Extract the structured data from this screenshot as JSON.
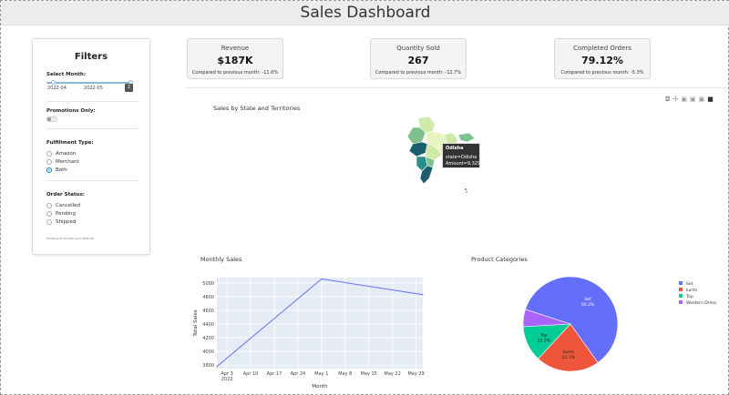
{
  "app": {
    "title": "Sales Dashboard"
  },
  "filters": {
    "title": "Filters",
    "select_month": {
      "label": "Select Month:",
      "tick_start": "2022-04",
      "tick_end": "2022-05",
      "handle_value": "2"
    },
    "promotions": {
      "label": "Promotions Only:"
    },
    "fulfillment": {
      "label": "Fulfillment Type:",
      "options": [
        "Amazon",
        "Merchant",
        "Both"
      ],
      "selected": "Both"
    },
    "order_status": {
      "label": "Order Status:",
      "options": [
        "Cancelled",
        "Pending",
        "Shipped"
      ]
    },
    "footnote": "Showing 13 records up to 2022-06"
  },
  "kpis": [
    {
      "title": "Revenue",
      "value": "$187K",
      "subtitle": "Compared to previous month: -11.0%"
    },
    {
      "title": "Quantity Sold",
      "value": "267",
      "subtitle": "Compared to previous month: -12.7%"
    },
    {
      "title": "Completed Orders",
      "value": "79.12%",
      "subtitle": "Compared to previous month: -5.3%"
    }
  ],
  "map": {
    "title": "Sales by State and Territories",
    "tooltip_header": "Odisha",
    "tooltip_line1": "state=Odisha",
    "tooltip_line2": "Amount=9,329.95",
    "colors": {
      "dark": "#1b5e6e",
      "teal": "#2a8f8a",
      "mid": "#7fc18e",
      "light": "#cfe9a6",
      "pale": "#e8f4c0"
    }
  },
  "toolbar": {
    "icons": [
      "camera-icon",
      "pan-icon",
      "zoom-in-icon",
      "zoom-out-icon",
      "reset-icon",
      "logo-icon"
    ]
  },
  "chart_data": [
    {
      "type": "line",
      "title": "Monthly Sales",
      "xlabel": "Month",
      "ylabel": "Total Sales",
      "x_ticks": [
        "Apr 3\n2022",
        "Apr 10",
        "Apr 17",
        "Apr 24",
        "May 1",
        "May 8",
        "May 15",
        "May 22",
        "May 29"
      ],
      "y_ticks": [
        3800,
        4000,
        4200,
        4400,
        4600,
        4800,
        5000
      ],
      "ylim": [
        3750,
        5080
      ],
      "x": [
        "2022-03-31",
        "2022-05-01",
        "2022-05-31"
      ],
      "y": [
        3780,
        5060,
        4830
      ],
      "color": "#636efa",
      "grid": true
    },
    {
      "type": "pie",
      "title": "Product Categories",
      "labels": [
        "Set",
        "kurta",
        "Top",
        "Western Dress"
      ],
      "values": [
        60.2,
        21.7,
        12.2,
        5.9
      ],
      "slice_labels": [
        "Set\n60.2%",
        "kurta\n21.7%",
        "Top\n12.2%",
        ""
      ],
      "colors": [
        "#636efa",
        "#ef553b",
        "#00cc96",
        "#ab63fa"
      ],
      "legend_position": "right"
    }
  ]
}
